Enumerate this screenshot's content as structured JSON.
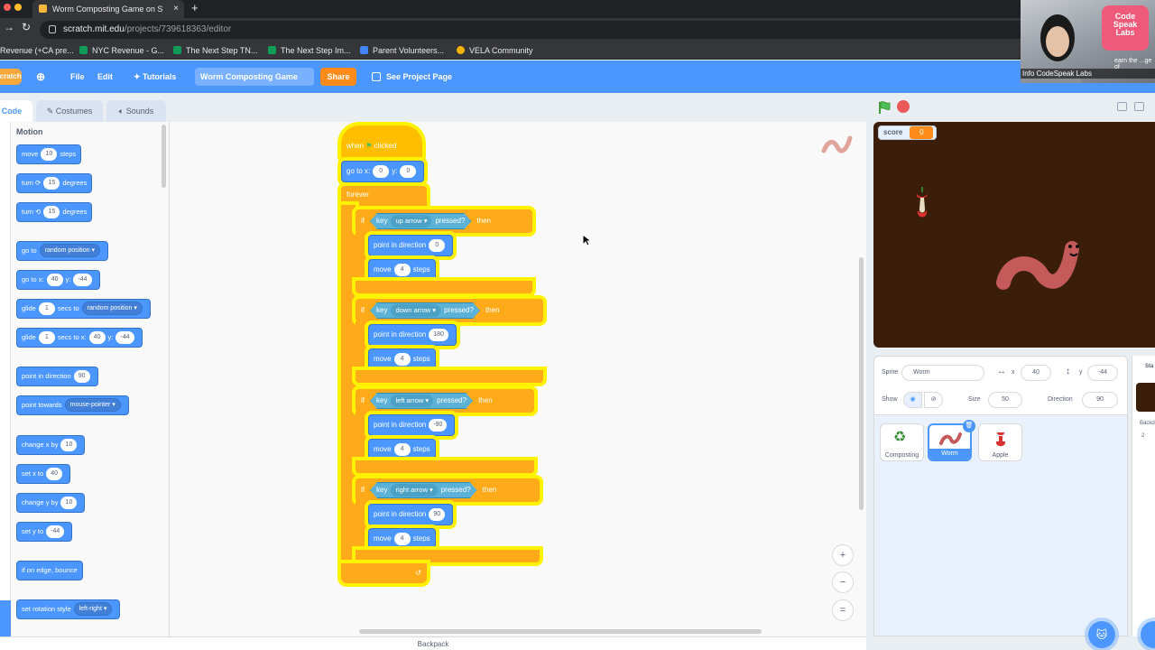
{
  "browser": {
    "tab_title": "Worm Composting Game on S",
    "tab_close": "×",
    "new_tab": "+",
    "url_host": "scratch.mit.edu",
    "url_path": "/projects/739618363/editor",
    "bookmarks": [
      {
        "label": "Revenue (+CA pre...",
        "color": "#f4b400"
      },
      {
        "label": "NYC Revenue - G...",
        "color": "#0f9d58"
      },
      {
        "label": "The Next Step TN...",
        "color": "#0f9d58"
      },
      {
        "label": "The Next Step Im...",
        "color": "#0f9d58"
      },
      {
        "label": "Parent Volunteers...",
        "color": "#4285f4"
      },
      {
        "label": "VELA Community",
        "color": "#f4b400"
      }
    ]
  },
  "menubar": {
    "logo": "Scratch",
    "file": "File",
    "edit": "Edit",
    "tutorials": "Tutorials",
    "project_title": "Worm Composting Game",
    "share": "Share",
    "see_project_page": "See Project Page"
  },
  "editor_tabs": {
    "code": "Code",
    "costumes": "Costumes",
    "sounds": "Sounds"
  },
  "palette": {
    "category": "Motion",
    "blocks": {
      "move": {
        "pre": "move",
        "val": "10",
        "post": "steps"
      },
      "turn_right": {
        "pre": "turn",
        "icon": "⟳",
        "val": "15",
        "post": "degrees"
      },
      "turn_left": {
        "pre": "turn",
        "icon": "⟲",
        "val": "15",
        "post": "degrees"
      },
      "goto_random": {
        "pre": "go to",
        "dd": "random position ▾"
      },
      "goto_xy": {
        "pre": "go to x:",
        "x": "40",
        "ymid": "y:",
        "y": "-44"
      },
      "glide_random": {
        "pre": "glide",
        "val": "1",
        "mid": "secs to",
        "dd": "random position ▾"
      },
      "glide_xy": {
        "pre": "glide",
        "val": "1",
        "mid": "secs to x:",
        "x": "40",
        "ymid": "y:",
        "y": "-44"
      },
      "point_dir": {
        "pre": "point in direction",
        "val": "90"
      },
      "point_towards": {
        "pre": "point towards",
        "dd": "mouse-pointer ▾"
      },
      "change_x": {
        "pre": "change x by",
        "val": "10"
      },
      "set_x": {
        "pre": "set x to",
        "val": "40"
      },
      "change_y": {
        "pre": "change y by",
        "val": "10"
      },
      "set_y": {
        "pre": "set y to",
        "val": "-44"
      },
      "bounce": {
        "pre": "if on edge, bounce"
      },
      "rotation_style": {
        "pre": "set rotation style",
        "dd": "left-right ▾"
      }
    }
  },
  "script": {
    "hat": {
      "when": "when",
      "clicked": "clicked"
    },
    "goto": {
      "pre": "go to x:",
      "x": "0",
      "ymid": "y:",
      "y": "0"
    },
    "forever": "forever",
    "loop_arrow": "↺",
    "ifs": [
      {
        "if": "if",
        "key": "key",
        "option": "up arrow ▾",
        "pressed": "pressed?",
        "then": "then",
        "dir_label": "point in direction",
        "dir": "0",
        "move_pre": "move",
        "move_val": "4",
        "move_post": "steps"
      },
      {
        "if": "if",
        "key": "key",
        "option": "down arrow ▾",
        "pressed": "pressed?",
        "then": "then",
        "dir_label": "point in direction",
        "dir": "180",
        "move_pre": "move",
        "move_val": "4",
        "move_post": "steps"
      },
      {
        "if": "if",
        "key": "key",
        "option": "left arrow ▾",
        "pressed": "pressed?",
        "then": "then",
        "dir_label": "point in direction",
        "dir": "-90",
        "move_pre": "move",
        "move_val": "4",
        "move_post": "steps"
      },
      {
        "if": "if",
        "key": "key",
        "option": "right arrow ▾",
        "pressed": "pressed?",
        "then": "then",
        "dir_label": "point in direction",
        "dir": "90",
        "move_pre": "move",
        "move_val": "4",
        "move_post": "steps"
      }
    ]
  },
  "zoom": {
    "in": "+",
    "out": "−",
    "reset": "="
  },
  "backpack": "Backpack",
  "stage": {
    "monitor_label": "score",
    "monitor_value": "0",
    "background_color": "#3a1e0a"
  },
  "sprite_info": {
    "sprite_label": "Sprite",
    "sprite_name": "Worm",
    "x_label": "x",
    "x": "40",
    "y_label": "y",
    "y": "-44",
    "show_label": "Show",
    "size_label": "Size",
    "size": "50",
    "direction_label": "Direction",
    "direction": "90"
  },
  "sprites": [
    {
      "name": "Composting",
      "selected": false
    },
    {
      "name": "Worm",
      "selected": true
    },
    {
      "name": "Apple",
      "selected": false
    }
  ],
  "stage_panel": {
    "label": "Sta",
    "backdrops": "Backd",
    "count": "2"
  },
  "webcam": {
    "caption": "Info CodeSpeak Labs",
    "badge_line1": "Code",
    "badge_line2": "Speak",
    "badge_line3": "Labs",
    "bg_text": "earn the ...ge of"
  }
}
